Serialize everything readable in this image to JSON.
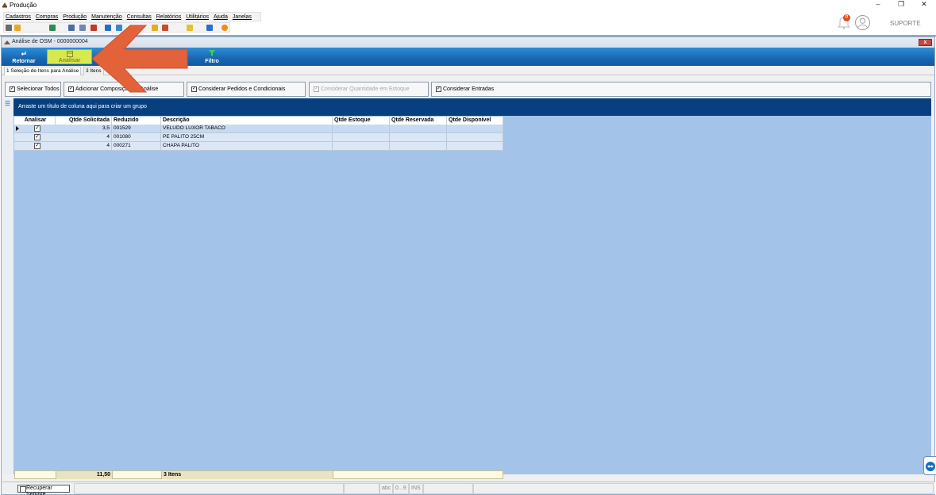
{
  "window": {
    "title": "Produção",
    "min": "–",
    "restore": "❐",
    "close": "✕"
  },
  "menu": [
    "Cadastros",
    "Compras",
    "Produção",
    "Manutenção",
    "Consultas",
    "Relatórios",
    "Utilitários",
    "Ajuda",
    "Janelas"
  ],
  "user": {
    "name": "SUPORTE",
    "notifications": "0"
  },
  "child": {
    "title": "Análise de OSM - 0000000004",
    "close": "x"
  },
  "ribbon": {
    "retornar": "Retornar",
    "analisar": "Analisar",
    "filtro": "Filtro"
  },
  "tabs": {
    "tab1": "1 Seleção de Itens para Análise",
    "tab2": "3 Itens"
  },
  "options": {
    "select_all": "Selecionar Todos",
    "add_composition": "Adicionar Composição na Análise",
    "consider_orders": "Considerar Pedidos e Condicionais",
    "consider_quantity": "Considerar Quantidade em Estoque",
    "consider_entries": "Considerar Entradas"
  },
  "grid": {
    "group_hint": "Arraste um título de coluna aqui para criar um grupo",
    "columns": [
      "Analisar",
      "Qtde Solicitada",
      "Reduzido",
      "Descrição",
      "Qtde Estoque",
      "Qtde Reservada",
      "Qtde Disponível"
    ],
    "rows": [
      {
        "qtde": "3,5",
        "reduzido": "001529",
        "descricao": "VELUDO LUXOR TABACO"
      },
      {
        "qtde": "4",
        "reduzido": "001080",
        "descricao": "PE PALITO 25CM"
      },
      {
        "qtde": "4",
        "reduzido": "000271",
        "descricao": "CHAPA PALITO"
      }
    ],
    "footer": {
      "total": "11,50",
      "count": "3 Itens"
    }
  },
  "status": {
    "recover": "Recuperar Sempre",
    "abc": "abc",
    "num": "0...9",
    "ins": "INS"
  },
  "colors": {
    "ribbon": "#1767b1",
    "groupbar": "#08407f",
    "gridarea": "#a3c3e9",
    "arrow": "#e2623a",
    "highlight": "#d8e94e"
  }
}
